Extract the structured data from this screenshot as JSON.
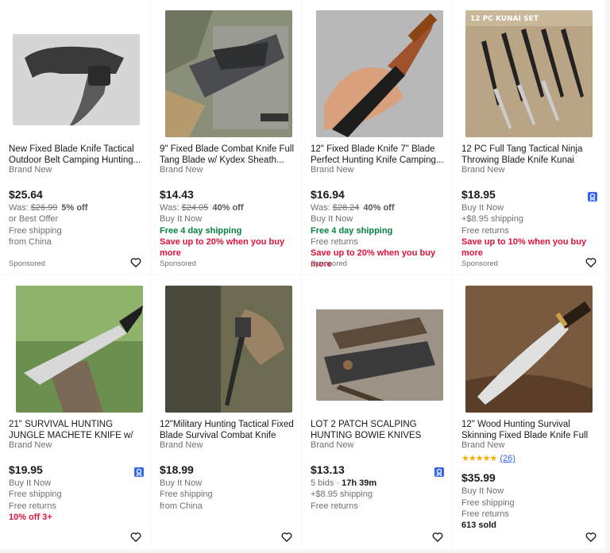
{
  "listings": [
    {
      "title": "New Fixed Blade Knife Tactical Outdoor Belt Camping Hunting...",
      "condition": "Brand New",
      "price": "$25.64",
      "was_label": "Was: ",
      "was_price": "$26.99",
      "discount": "5% off",
      "line1": "or Best Offer",
      "line2": "Free shipping",
      "line3": "from China",
      "sponsored": "Sponsored"
    },
    {
      "title": "9\" Fixed Blade Combat Knife Full Tang Blade w/ Kydex Sheath...",
      "condition": "Brand New",
      "price": "$14.43",
      "was_label": "Was: ",
      "was_price": "$24.05",
      "discount": "40% off",
      "line1": "Buy It Now",
      "green": "Free 4 day shipping",
      "red": "Save up to 20% when you buy more",
      "sponsored": "Sponsored"
    },
    {
      "title": "12\" Fixed Blade Knife 7\" Blade Perfect Hunting Knife Camping...",
      "condition": "Brand New",
      "price": "$16.94",
      "was_label": "Was: ",
      "was_price": "$28.24",
      "discount": "40% off",
      "line1": "Buy It Now",
      "green": "Free 4 day shipping",
      "line2": "Free returns",
      "red": "Save up to 20% when you buy more",
      "sponsored": "Sponsored"
    },
    {
      "title": "12 PC Full Tang Tactical Ninja Throwing Blade Knife Kunai Ninjuts...",
      "condition": "Brand New",
      "price": "$18.95",
      "line1": "Buy It Now",
      "line2": "+$8.95 shipping",
      "line3": "Free returns",
      "red": "Save up to 10% when you buy more",
      "sponsored": "Sponsored",
      "image_text": "12 PC KUNAI SET"
    },
    {
      "title": "21\" SURVIVAL HUNTING JUNGLE MACHETE KNIFE w/ SHEATH Fixed...",
      "condition": "Brand New",
      "price": "$19.95",
      "line1": "Buy It Now",
      "line2": "Free shipping",
      "line3": "Free returns",
      "red": "10% off 3+"
    },
    {
      "title": "12\"Military Hunting Tactical Fixed Blade Survival Combat Knife with...",
      "condition": "Brand New",
      "price": "$18.99",
      "line1": "Buy It Now",
      "line2": "Free shipping",
      "line3": "from China"
    },
    {
      "title": "LOT 2 PATCH SCALPING HUNTING BOWIE KNIVES KNIFE W/ BEADED...",
      "condition": "Brand New",
      "price": "$13.13",
      "bids": "5 bids",
      "sep": " · ",
      "time_left": "17h 39m",
      "line2": "+$8.95 shipping",
      "line3": "Free returns"
    },
    {
      "title": "12\" Wood Hunting Survival Skinning Fixed Blade Knife Full Tang Army...",
      "condition": "Brand New",
      "stars": "★★★★★",
      "rating": 4.5,
      "review_count": "(26)",
      "price": "$35.99",
      "line1": "Buy It Now",
      "line2": "Free shipping",
      "line3": "Free returns",
      "sold": "613 sold"
    }
  ],
  "colors": {
    "green": "#05823f",
    "red": "#e0103a",
    "link": "#3665f3",
    "badge": "#3665f3",
    "star": "#f4ae01"
  },
  "icons": {
    "watch": "heart-icon",
    "badge": "authenticity-badge-icon"
  }
}
